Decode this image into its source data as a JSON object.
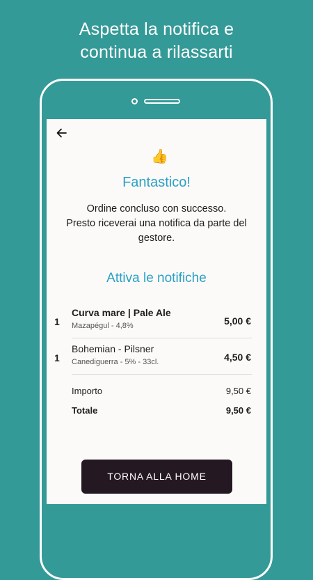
{
  "headline": {
    "line1": "Aspetta la notifica e",
    "line2": "continua a rilassarti"
  },
  "screen": {
    "back_icon": "arrow-left-icon",
    "success_icon": "thumbs-up-icon",
    "title": "Fantastico!",
    "message_lines": [
      "Ordine concluso con successo.",
      "Presto riceverai una notifica da parte del",
      "gestore."
    ],
    "notifications_link": "Attiva le notifiche",
    "items": [
      {
        "qty": "1",
        "name": "Curva mare | Pale Ale",
        "sub": "Mazapégul - 4,8%",
        "price": "5,00 €"
      },
      {
        "qty": "1",
        "name": "Bohemian - Pilsner",
        "sub": "Canediguerra - 5% - 33cl.",
        "price": "4,50 €"
      }
    ],
    "summary": {
      "amount_label": "Importo",
      "amount_value": "9,50 €",
      "total_label": "Totale",
      "total_value": "9,50 €"
    },
    "home_button": "TORNA ALLA HOME"
  },
  "colors": {
    "background": "#349a97",
    "accent": "#2aa1c6",
    "button": "#241922"
  }
}
